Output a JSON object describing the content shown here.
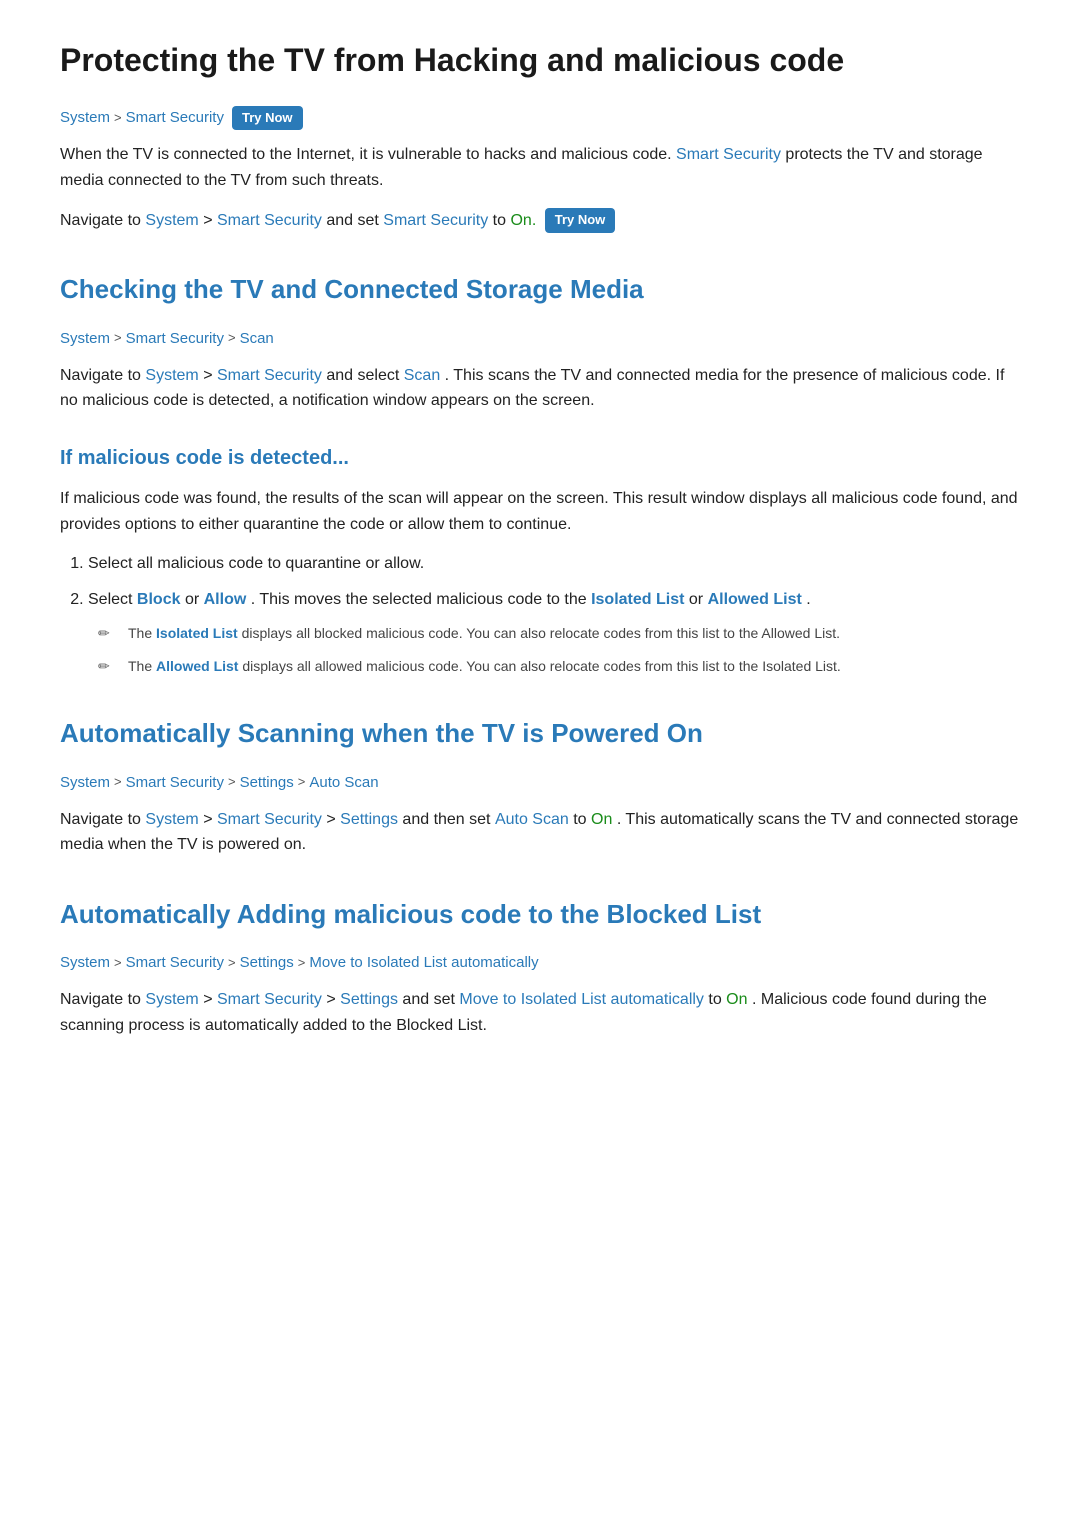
{
  "page": {
    "title": "Protecting the TV from Hacking and malicious code",
    "intro_paragraph_1": "When the TV is connected to the Internet, it is vulnerable to hacks and malicious code.",
    "intro_link_smart_security": "Smart Security",
    "intro_paragraph_1b": "protects the TV and storage media connected to the TV from such threats.",
    "intro_paragraph_2_prefix": "Navigate to",
    "intro_paragraph_2_system": "System",
    "intro_paragraph_2_smart_security": "Smart Security",
    "intro_paragraph_2_suffix": "and set",
    "intro_paragraph_2_smart_security2": "Smart Security",
    "intro_paragraph_2_to": "to",
    "intro_paragraph_2_on": "On.",
    "breadcrumb_1": {
      "system": "System",
      "sep1": ">",
      "smart_security": "Smart Security",
      "try_now": "Try Now"
    },
    "section2": {
      "heading": "Checking the TV and Connected Storage Media",
      "breadcrumb": {
        "system": "System",
        "sep1": ">",
        "smart_security": "Smart Security",
        "sep2": ">",
        "scan": "Scan"
      },
      "paragraph": "Navigate to",
      "system": "System",
      "smart_security": "Smart Security",
      "and_select": "and select",
      "scan": "Scan",
      "paragraph_rest": ". This scans the TV and connected media for the presence of malicious code. If no malicious code is detected, a notification window appears on the screen."
    },
    "section3": {
      "heading": "If malicious code is detected...",
      "paragraph1": "If malicious code was found, the results of the scan will appear on the screen. This result window displays all malicious code found, and provides options to either quarantine the code or allow them to continue.",
      "list_item1": "Select all malicious code to quarantine or allow.",
      "list_item2_prefix": "Select",
      "list_item2_block": "Block",
      "list_item2_or": "or",
      "list_item2_allow": "Allow",
      "list_item2_middle": ". This moves the selected malicious code to the",
      "list_item2_isolated": "Isolated List",
      "list_item2_or2": "or",
      "list_item2_allowed": "Allowed List",
      "list_item2_suffix": ".",
      "note1_prefix": "The",
      "note1_isolated": "Isolated List",
      "note1_rest": "displays all blocked malicious code. You can also relocate codes from this list to the Allowed List.",
      "note2_prefix": "The",
      "note2_allowed": "Allowed List",
      "note2_rest": "displays all allowed malicious code. You can also relocate codes from this list to the Isolated List."
    },
    "section4": {
      "heading": "Automatically Scanning when the TV is Powered On",
      "breadcrumb": {
        "system": "System",
        "sep1": ">",
        "smart_security": "Smart Security",
        "sep2": ">",
        "settings": "Settings",
        "sep3": ">",
        "auto_scan": "Auto Scan"
      },
      "paragraph_prefix": "Navigate to",
      "system": "System",
      "smart_security": "Smart Security",
      "settings": "Settings",
      "and_then": "and then set",
      "auto_scan": "Auto Scan",
      "to": "to",
      "on": "On",
      "paragraph_rest": ". This automatically scans the TV and connected storage media when the TV is powered on."
    },
    "section5": {
      "heading": "Automatically Adding malicious code to the Blocked List",
      "breadcrumb": {
        "system": "System",
        "sep1": ">",
        "smart_security": "Smart Security",
        "sep2": ">",
        "settings": "Settings",
        "sep3": ">",
        "move_to_isolated": "Move to Isolated List automatically"
      },
      "paragraph_prefix": "Navigate to",
      "system": "System",
      "smart_security": "Smart Security",
      "settings": "Settings",
      "and_set": "and set",
      "move_to_isolated": "Move to Isolated List automatically",
      "to": "to",
      "on": "On",
      "paragraph_rest": ". Malicious code found during the scanning process is automatically added to the Blocked List."
    }
  }
}
